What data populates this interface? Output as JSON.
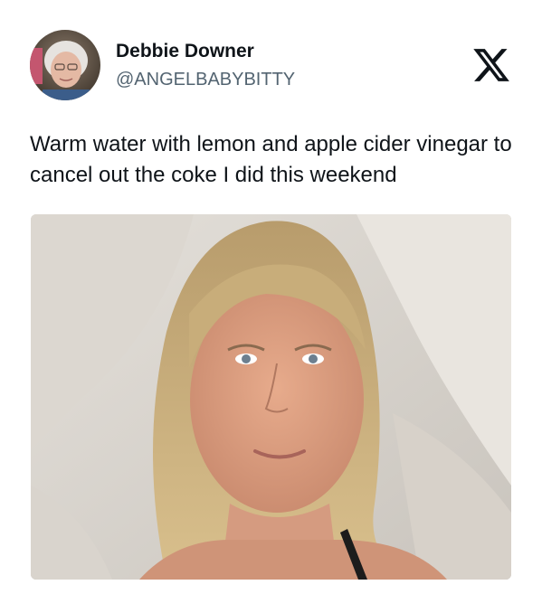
{
  "tweet": {
    "display_name": "Debbie Downer",
    "handle": "@ANGELBABYBITTY",
    "text": "Warm water with lemon and apple cider vinegar to cancel out the coke I did this weekend"
  },
  "icons": {
    "brand": "x-logo-icon"
  },
  "colors": {
    "text_primary": "#0f1419",
    "text_secondary": "#536471",
    "background": "#ffffff"
  }
}
